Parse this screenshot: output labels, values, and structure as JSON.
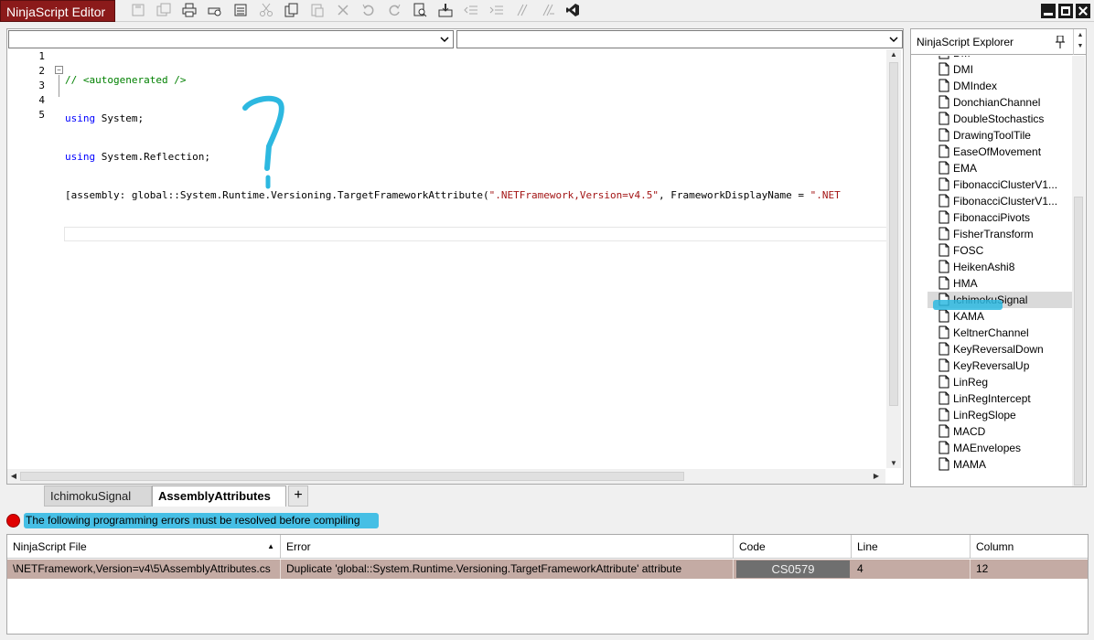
{
  "app": {
    "title": "NinjaScript Editor"
  },
  "toolbar": {
    "icons": [
      "save-icon",
      "save-all-icon",
      "print-icon",
      "print-preview-icon",
      "properties-icon",
      "cut-icon",
      "copy-icon",
      "paste-icon",
      "delete-icon",
      "undo-icon",
      "redo-icon",
      "find-icon",
      "compile-icon",
      "outdent-icon",
      "indent-icon",
      "comment-icon",
      "uncomment-icon",
      "visual-studio-icon"
    ]
  },
  "editor": {
    "line_numbers": [
      "1",
      "2",
      "3",
      "4",
      "5"
    ],
    "code": {
      "l1_comment": "// <autogenerated />",
      "l2_kw": "using",
      "l2_rest": " System;",
      "l3_kw": "using",
      "l3_rest": " System.Reflection;",
      "l4_a": "[assembly: global::System.Runtime.Versioning.TargetFrameworkAttribute(",
      "l4_str1": "\".NETFramework,Version=v4.5\"",
      "l4_b": ", FrameworkDisplayName = ",
      "l4_str2": "\".NET"
    }
  },
  "explorer": {
    "title": "NinjaScript Explorer",
    "items": [
      "DM",
      "DMI",
      "DMIndex",
      "DonchianChannel",
      "DoubleStochastics",
      "DrawingToolTile",
      "EaseOfMovement",
      "EMA",
      "FibonacciClusterV1...",
      "FibonacciClusterV1...",
      "FibonacciPivots",
      "FisherTransform",
      "FOSC",
      "HeikenAshi8",
      "HMA",
      "IchimokuSignal",
      "KAMA",
      "KeltnerChannel",
      "KeyReversalDown",
      "KeyReversalUp",
      "LinReg",
      "LinRegIntercept",
      "LinRegSlope",
      "MACD",
      "MAEnvelopes",
      "MAMA"
    ],
    "selected": "IchimokuSignal"
  },
  "tabs": {
    "tab1": "IchimokuSignal",
    "tab2": "AssemblyAttributes",
    "add": "+"
  },
  "status": {
    "message": "The following programming errors must be resolved before compiling",
    "color": "#e00000"
  },
  "errors": {
    "headers": {
      "file": "NinjaScript File",
      "error": "Error",
      "code": "Code",
      "line": "Line",
      "column": "Column"
    },
    "rows": [
      {
        "file": "\\NETFramework,Version=v4\\5\\AssemblyAttributes.cs",
        "error": "Duplicate 'global::System.Runtime.Versioning.TargetFrameworkAttribute' attribute",
        "code": "CS0579",
        "line": "4",
        "column": "12"
      }
    ]
  },
  "colors": {
    "title_bg": "#8b1a1a",
    "highlight": "#2db8e0",
    "error_row": "#c4aba4"
  }
}
